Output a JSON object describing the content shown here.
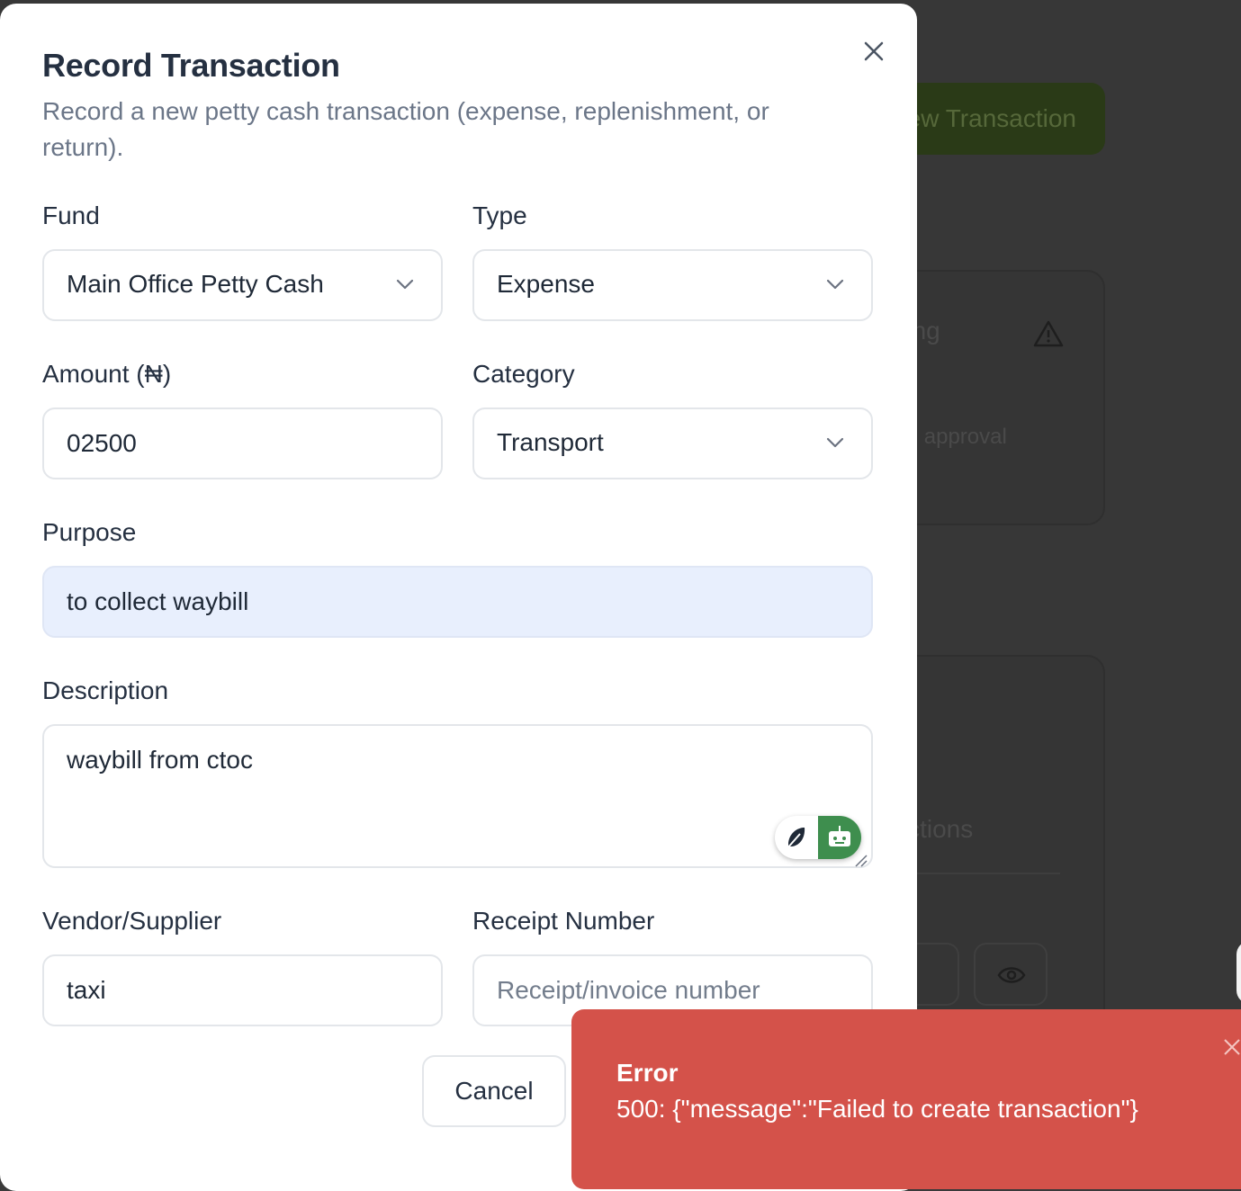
{
  "background": {
    "new_transaction_button": "New Transaction",
    "pending_card": {
      "title": "Pending",
      "subtitle": "Pending approval"
    },
    "transactions_card": {
      "title": "Transactions"
    }
  },
  "dialog": {
    "title": "Record Transaction",
    "subtitle": "Record a new petty cash transaction (expense, replenishment, or return).",
    "fund": {
      "label": "Fund",
      "value": "Main Office Petty Cash"
    },
    "type": {
      "label": "Type",
      "value": "Expense"
    },
    "amount": {
      "label": "Amount (₦)",
      "value": "02500"
    },
    "category": {
      "label": "Category",
      "value": "Transport"
    },
    "purpose": {
      "label": "Purpose",
      "value": "to collect waybill"
    },
    "description": {
      "label": "Description",
      "value": "waybill from ctoc"
    },
    "vendor": {
      "label": "Vendor/Supplier",
      "value": "taxi"
    },
    "receipt": {
      "label": "Receipt Number",
      "placeholder": "Receipt/invoice number"
    },
    "cancel_label": "Cancel"
  },
  "toast": {
    "title": "Error",
    "message": "500: {\"message\":\"Failed to create transaction\"}"
  },
  "colors": {
    "toast_bg": "#d4524a",
    "purpose_bg": "#e8effd",
    "bg_accent_button": "#2a3a17"
  }
}
